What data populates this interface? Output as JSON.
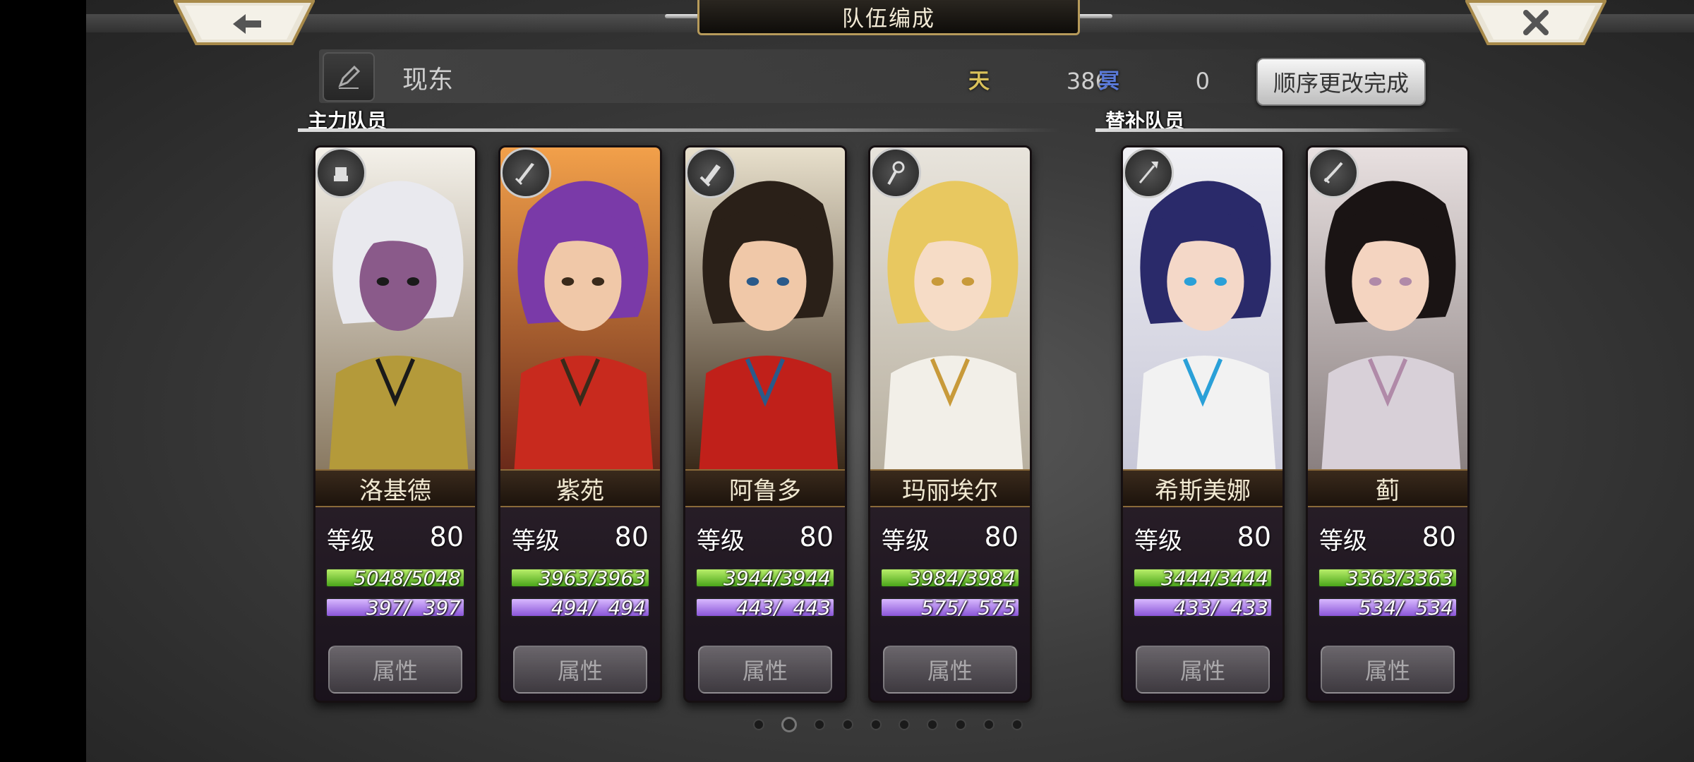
{
  "header": {
    "title": "队伍编成",
    "back_icon": "back-arrow-icon",
    "close_icon": "close-x-icon"
  },
  "team": {
    "name": "现东",
    "stat_a_icon": "天",
    "stat_a_value": "386",
    "stat_b_icon": "冥",
    "stat_b_value": "0",
    "done_button": "顺序更改完成"
  },
  "sections": {
    "main": "主力队员",
    "sub": "替补队员"
  },
  "level_label": "等级",
  "attr_label": "属性",
  "colors": {
    "hp_bar": "#4aa51a",
    "mp_bar": "#8a56d8",
    "gold_trim": "#b69a5a"
  },
  "cards": [
    {
      "name": "洛基德",
      "level": "80",
      "hp": "5048/5048",
      "mp": " 397/  397",
      "hp_ratio": 1,
      "mp_ratio": 1,
      "weapon": "fist-icon",
      "role": "main"
    },
    {
      "name": "紫苑",
      "level": "80",
      "hp": "3963/3963",
      "mp": " 494/  494",
      "hp_ratio": 1,
      "mp_ratio": 1,
      "weapon": "sword-icon",
      "role": "main"
    },
    {
      "name": "阿鲁多",
      "level": "80",
      "hp": "3944/3944",
      "mp": " 443/  443",
      "hp_ratio": 1,
      "mp_ratio": 1,
      "weapon": "greatsword-icon",
      "role": "main"
    },
    {
      "name": "玛丽埃尔",
      "level": "80",
      "hp": "3984/3984",
      "mp": " 575/  575",
      "hp_ratio": 1,
      "mp_ratio": 1,
      "weapon": "staff-icon",
      "role": "main"
    },
    {
      "name": "希斯美娜",
      "level": "80",
      "hp": "3444/3444",
      "mp": " 433/  433",
      "hp_ratio": 1,
      "mp_ratio": 1,
      "weapon": "spear-icon",
      "role": "sub"
    },
    {
      "name": "蓟",
      "level": "80",
      "hp": "3363/3363",
      "mp": " 534/  534",
      "hp_ratio": 1,
      "mp_ratio": 1,
      "weapon": "katana-icon",
      "role": "sub"
    }
  ],
  "pager": {
    "count": 10,
    "active": 1
  }
}
